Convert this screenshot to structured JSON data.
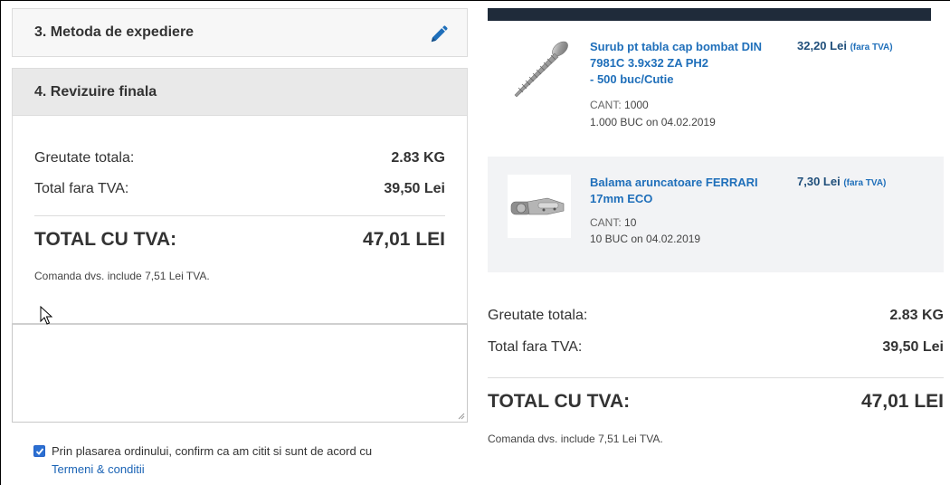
{
  "left": {
    "shipping_step": {
      "title": "3. Metoda de expediere"
    },
    "review_step": {
      "title": "4. Revizuire finala"
    },
    "summary": {
      "weight_label": "Greutate totala:",
      "weight_value": "2.83 KG",
      "subtotal_label": "Total fara TVA:",
      "subtotal_value": "39,50 Lei",
      "total_label": "TOTAL CU TVA:",
      "total_value": "47,01 LEI",
      "vat_note": "Comanda dvs. include 7,51 Lei TVA."
    },
    "comment": {
      "value": ""
    },
    "terms": {
      "checked": true,
      "text": "Prin plasarea ordinului, confirm ca am citit si sunt de acord cu",
      "link": "Termeni & conditii"
    }
  },
  "cart": {
    "items": [
      {
        "name": "Surub pt tabla cap bombat DIN 7981C 3.9x32 ZA PH2 - 500 buc/Cutie",
        "name_lines": [
          "Surub pt tabla cap bombat DIN",
          "7981C 3.9x32 ZA PH2",
          "- 500 buc/Cutie"
        ],
        "price": "32,20 Lei",
        "price_vat": "(fara TVA)",
        "qty_label": "CANT:",
        "qty_value": "1000",
        "shipping": "1.000 BUC on 04.02.2019",
        "icon": "screw-image"
      },
      {
        "name": "Balama aruncatoare FERRARI 17mm ECO",
        "name_lines": [
          "Balama aruncatoare FERRARI",
          "17mm ECO"
        ],
        "price": "7,30 Lei",
        "price_vat": "(fara TVA)",
        "qty_label": "CANT:",
        "qty_value": "10",
        "shipping": "10 BUC on 04.02.2019",
        "icon": "hinge-image"
      }
    ]
  },
  "right_summary": {
    "weight_label": "Greutate totala:",
    "weight_value": "2.83 KG",
    "subtotal_label": "Total fara TVA:",
    "subtotal_value": "39,50 Lei",
    "total_label": "TOTAL CU TVA:",
    "total_value": "47,01 LEI",
    "vat_note": "Comanda dvs. include 7,51 Lei TVA."
  },
  "colors": {
    "link": "#1f6fba",
    "header_bar": "#1f2b3a",
    "panel_bg": "#f7f7f7",
    "active_panel_bg": "#e9e9e9",
    "item_alt_bg": "#f2f3f5"
  }
}
